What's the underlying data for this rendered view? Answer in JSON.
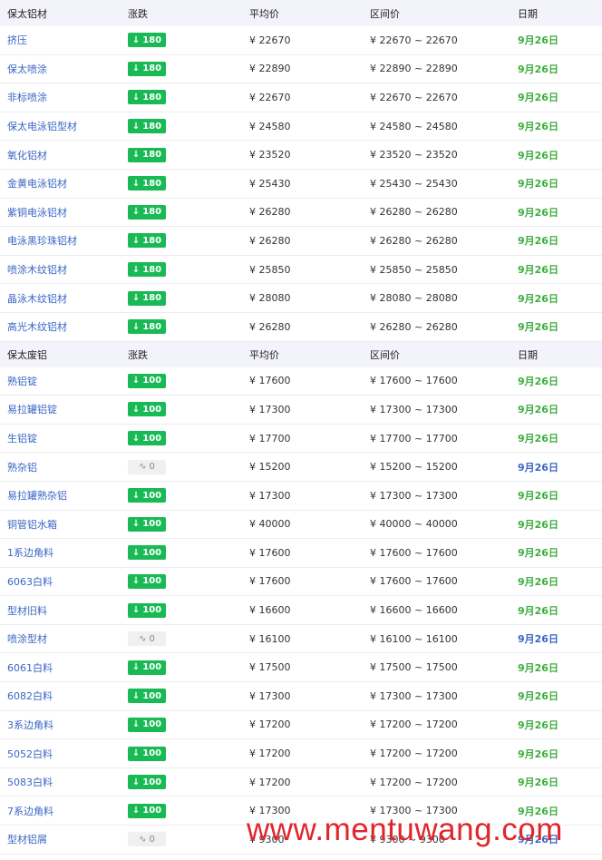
{
  "colors": {
    "header_bg": "#f3f3fb",
    "down_green": "#19b955",
    "name_blue": "#3a66c4",
    "date_green": "#3cae3c",
    "watermark_red": "#e0262c"
  },
  "section1": {
    "header": {
      "name": "保太铝材",
      "change": "涨跌",
      "avg": "平均价",
      "range": "区间价",
      "date": "日期"
    },
    "rows": [
      {
        "name": "挤压",
        "change": "180",
        "trend": "down",
        "avg": "¥ 22670",
        "range": "¥ 22670 ~ 22670",
        "date": "9月26日"
      },
      {
        "name": "保太喷涂",
        "change": "180",
        "trend": "down",
        "avg": "¥ 22890",
        "range": "¥ 22890 ~ 22890",
        "date": "9月26日"
      },
      {
        "name": "非标喷涂",
        "change": "180",
        "trend": "down",
        "avg": "¥ 22670",
        "range": "¥ 22670 ~ 22670",
        "date": "9月26日"
      },
      {
        "name": "保太电泳铝型材",
        "change": "180",
        "trend": "down",
        "avg": "¥ 24580",
        "range": "¥ 24580 ~ 24580",
        "date": "9月26日"
      },
      {
        "name": "氧化铝材",
        "change": "180",
        "trend": "down",
        "avg": "¥ 23520",
        "range": "¥ 23520 ~ 23520",
        "date": "9月26日"
      },
      {
        "name": "金黄电泳铝材",
        "change": "180",
        "trend": "down",
        "avg": "¥ 25430",
        "range": "¥ 25430 ~ 25430",
        "date": "9月26日"
      },
      {
        "name": "紫铜电泳铝材",
        "change": "180",
        "trend": "down",
        "avg": "¥ 26280",
        "range": "¥ 26280 ~ 26280",
        "date": "9月26日"
      },
      {
        "name": "电泳黑珍珠铝材",
        "change": "180",
        "trend": "down",
        "avg": "¥ 26280",
        "range": "¥ 26280 ~ 26280",
        "date": "9月26日"
      },
      {
        "name": "喷涂木纹铝材",
        "change": "180",
        "trend": "down",
        "avg": "¥ 25850",
        "range": "¥ 25850 ~ 25850",
        "date": "9月26日"
      },
      {
        "name": "晶泳木纹铝材",
        "change": "180",
        "trend": "down",
        "avg": "¥ 28080",
        "range": "¥ 28080 ~ 28080",
        "date": "9月26日"
      },
      {
        "name": "高光木纹铝材",
        "change": "180",
        "trend": "down",
        "avg": "¥ 26280",
        "range": "¥ 26280 ~ 26280",
        "date": "9月26日"
      }
    ]
  },
  "section2": {
    "header": {
      "name": "保太废铝",
      "change": "涨跌",
      "avg": "平均价",
      "range": "区间价",
      "date": "日期"
    },
    "rows": [
      {
        "name": "熟铝锭",
        "change": "100",
        "trend": "down",
        "avg": "¥ 17600",
        "range": "¥ 17600 ~ 17600",
        "date": "9月26日"
      },
      {
        "name": "易拉罐铝锭",
        "change": "100",
        "trend": "down",
        "avg": "¥ 17300",
        "range": "¥ 17300 ~ 17300",
        "date": "9月26日"
      },
      {
        "name": "生铝锭",
        "change": "100",
        "trend": "down",
        "avg": "¥ 17700",
        "range": "¥ 17700 ~ 17700",
        "date": "9月26日"
      },
      {
        "name": "熟杂铝",
        "change": "0",
        "trend": "flat",
        "avg": "¥ 15200",
        "range": "¥ 15200 ~ 15200",
        "date": "9月26日"
      },
      {
        "name": "易拉罐熟杂铝",
        "change": "100",
        "trend": "down",
        "avg": "¥ 17300",
        "range": "¥ 17300 ~ 17300",
        "date": "9月26日"
      },
      {
        "name": "铜管铝水箱",
        "change": "100",
        "trend": "down",
        "avg": "¥ 40000",
        "range": "¥ 40000 ~ 40000",
        "date": "9月26日"
      },
      {
        "name": "1系边角料",
        "change": "100",
        "trend": "down",
        "avg": "¥ 17600",
        "range": "¥ 17600 ~ 17600",
        "date": "9月26日"
      },
      {
        "name": "6063白料",
        "change": "100",
        "trend": "down",
        "avg": "¥ 17600",
        "range": "¥ 17600 ~ 17600",
        "date": "9月26日"
      },
      {
        "name": "型材旧料",
        "change": "100",
        "trend": "down",
        "avg": "¥ 16600",
        "range": "¥ 16600 ~ 16600",
        "date": "9月26日"
      },
      {
        "name": "喷涂型材",
        "change": "0",
        "trend": "flat",
        "avg": "¥ 16100",
        "range": "¥ 16100 ~ 16100",
        "date": "9月26日"
      },
      {
        "name": "6061白料",
        "change": "100",
        "trend": "down",
        "avg": "¥ 17500",
        "range": "¥ 17500 ~ 17500",
        "date": "9月26日"
      },
      {
        "name": "6082白料",
        "change": "100",
        "trend": "down",
        "avg": "¥ 17300",
        "range": "¥ 17300 ~ 17300",
        "date": "9月26日"
      },
      {
        "name": "3系边角料",
        "change": "100",
        "trend": "down",
        "avg": "¥ 17200",
        "range": "¥ 17200 ~ 17200",
        "date": "9月26日"
      },
      {
        "name": "5052白料",
        "change": "100",
        "trend": "down",
        "avg": "¥ 17200",
        "range": "¥ 17200 ~ 17200",
        "date": "9月26日"
      },
      {
        "name": "5083白料",
        "change": "100",
        "trend": "down",
        "avg": "¥ 17200",
        "range": "¥ 17200 ~ 17200",
        "date": "9月26日"
      },
      {
        "name": "7系边角料",
        "change": "100",
        "trend": "down",
        "avg": "¥ 17300",
        "range": "¥ 17300 ~ 17300",
        "date": "9月26日"
      },
      {
        "name": "型材铝屑",
        "change": "0",
        "trend": "flat",
        "avg": "¥ 9300",
        "range": "¥ 9300 ~ 9300",
        "date": "9月26日"
      }
    ]
  },
  "watermark": {
    "text": "www.mentuwang.com"
  }
}
